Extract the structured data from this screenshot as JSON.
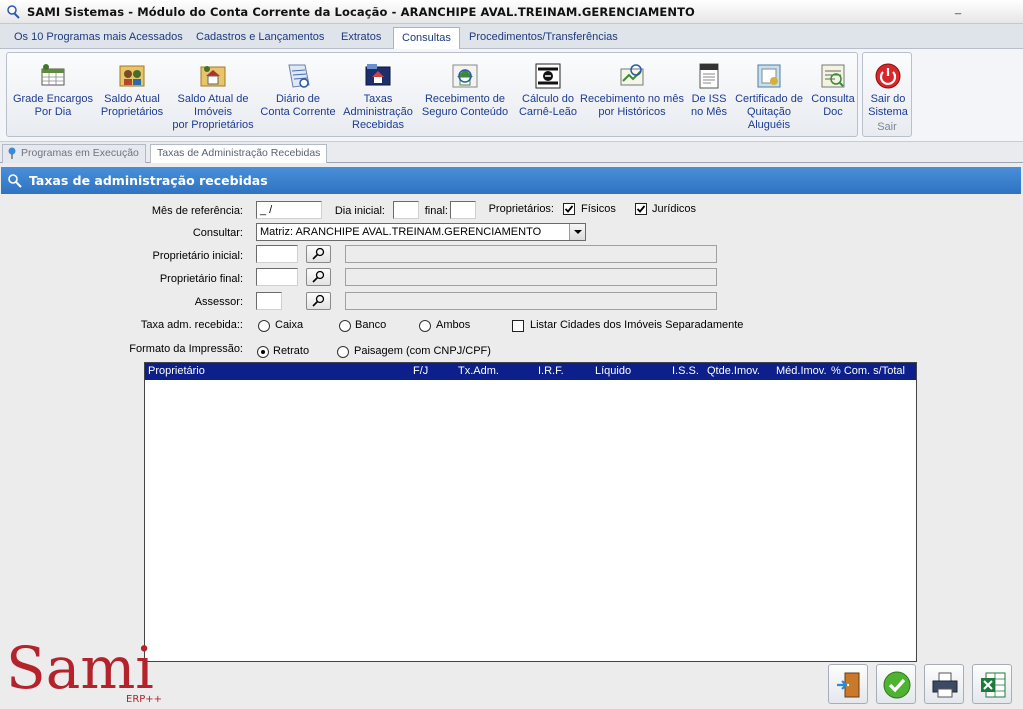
{
  "window": {
    "title": "SAMI Sistemas - Módulo do Conta Corrente da Locação - ARANCHIPE AVAL.TREINAM.GERENCIAMENTO",
    "minimize_label": "_"
  },
  "menu": {
    "tabs": [
      {
        "label": "Os 10 Programas mais Acessados"
      },
      {
        "label": "Cadastros e Lançamentos"
      },
      {
        "label": "Extratos"
      },
      {
        "label": "Consultas"
      },
      {
        "label": "Procedimentos/Transferências"
      }
    ],
    "active": "Consultas"
  },
  "ribbon": {
    "buttons": [
      {
        "line1": "Grade Encargos",
        "line2": "Por Dia",
        "line3": "",
        "icon": "grid-charges-icon"
      },
      {
        "line1": "Saldo Atual",
        "line2": "Proprietários",
        "line3": "",
        "icon": "owners-balance-icon"
      },
      {
        "line1": "Saldo Atual de",
        "line2": "Imóveis",
        "line3": "por Proprietários",
        "icon": "property-balance-icon"
      },
      {
        "line1": "Diário de",
        "line2": "Conta Corrente",
        "line3": "",
        "icon": "journal-icon"
      },
      {
        "line1": "Taxas",
        "line2": "Administração",
        "line3": "Recebidas",
        "icon": "admin-fees-icon"
      },
      {
        "line1": "Recebimento de",
        "line2": "Seguro Conteúdo",
        "line3": "",
        "icon": "insurance-icon"
      },
      {
        "line1": "Cálculo do",
        "line2": "Carnê-Leão",
        "line3": "",
        "icon": "tax-calc-icon"
      },
      {
        "line1": "Recebimento no mês",
        "line2": "por Históricos",
        "line3": "",
        "icon": "monthly-receipts-icon"
      },
      {
        "line1": "De ISS",
        "line2": "no Mês",
        "line3": "",
        "icon": "iss-icon"
      },
      {
        "line1": "Certificado de",
        "line2": "Quitação",
        "line3": "Aluguéis",
        "icon": "certificate-icon"
      },
      {
        "line1": "Consulta",
        "line2": "Doc",
        "line3": "",
        "icon": "doc-query-icon"
      }
    ],
    "exit": {
      "line1": "Sair do",
      "line2": "Sistema",
      "group": "Sair",
      "icon": "power-icon"
    }
  },
  "subtabs": [
    {
      "label": "Programas em Execução"
    },
    {
      "label": "Taxas de Administração Recebidas"
    }
  ],
  "panel": {
    "title": "Taxas de administração recebidas"
  },
  "form": {
    "mes_label": "Mês de referência:",
    "mes_value": "_ /",
    "dia_inicial_label": "Dia inicial:",
    "final_label": "final:",
    "proprietarios_label": "Proprietários:",
    "fisicos_label": "Físicos",
    "fisicos_checked": true,
    "juridicos_label": "Jurídicos",
    "juridicos_checked": true,
    "consultar_label": "Consultar:",
    "consultar_value": "Matriz: ARANCHIPE AVAL.TREINAM.GERENCIAMENTO",
    "prop_inicial_label": "Proprietário inicial:",
    "prop_final_label": "Proprietário final:",
    "assessor_label": "Assessor:",
    "taxa_label": "Taxa adm. recebida::",
    "taxa_options": [
      "Caixa",
      "Banco",
      "Ambos"
    ],
    "listar_label": "Listar Cidades dos Imóveis Separadamente",
    "listar_checked": false,
    "formato_label": "Formato da Impressão:",
    "formato_options": [
      "Retrato",
      "Paisagem (com CNPJ/CPF)"
    ],
    "formato_selected": "Retrato"
  },
  "grid": {
    "columns": [
      "Proprietário",
      "F/J",
      "Tx.Adm.",
      "I.R.F.",
      "Líquido",
      "I.S.S.",
      "Qtde.Imov.",
      "Méd.Imov.",
      "% Com. s/Total"
    ],
    "rows": []
  },
  "bottom_buttons": [
    {
      "name": "exit-door-icon"
    },
    {
      "name": "confirm-check-icon"
    },
    {
      "name": "printer-icon"
    },
    {
      "name": "excel-icon"
    }
  ],
  "logo": {
    "text": "Sami",
    "sub": "ERP++",
    "color": "#b4232b"
  },
  "colors": {
    "panel_header": "#2f73c2",
    "grid_header": "#0c1f8a",
    "link": "#1c3c92"
  }
}
